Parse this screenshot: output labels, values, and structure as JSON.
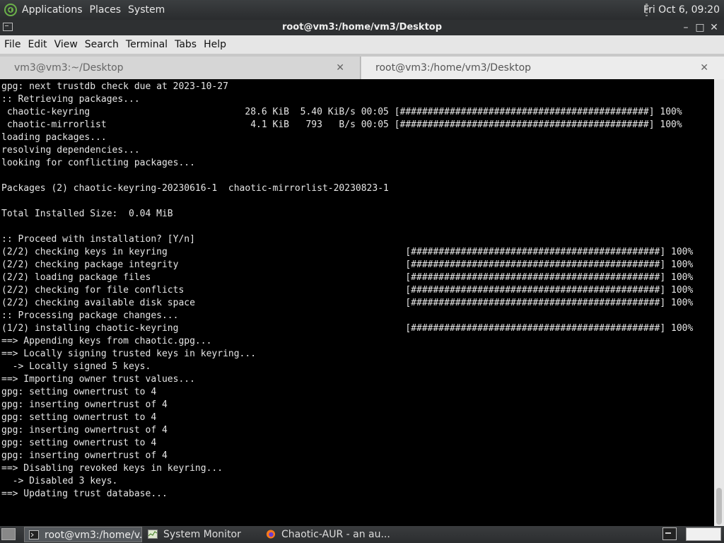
{
  "top_panel": {
    "menus": [
      "Applications",
      "Places",
      "System"
    ],
    "clock": "Fri Oct  6, 09:20"
  },
  "window": {
    "title": "root@vm3:/home/vm3/Desktop",
    "controls": {
      "minimize": "–",
      "maximize": "□",
      "close": "✕"
    }
  },
  "menubar": [
    "File",
    "Edit",
    "View",
    "Search",
    "Terminal",
    "Tabs",
    "Help"
  ],
  "tabs": [
    {
      "label": "vm3@vm3:~/Desktop",
      "close": "✕"
    },
    {
      "label": "root@vm3:/home/vm3/Desktop",
      "close": "✕"
    }
  ],
  "terminal": {
    "lines": [
      "gpg: next trustdb check due at 2023-10-27",
      ":: Retrieving packages...",
      " chaotic-keyring                            28.6 KiB  5.40 KiB/s 00:05 [#############################################] 100%",
      " chaotic-mirrorlist                          4.1 KiB   793   B/s 00:05 [#############################################] 100%",
      "loading packages...",
      "resolving dependencies...",
      "looking for conflicting packages...",
      "",
      "Packages (2) chaotic-keyring-20230616-1  chaotic-mirrorlist-20230823-1",
      "",
      "Total Installed Size:  0.04 MiB",
      "",
      ":: Proceed with installation? [Y/n]",
      "(2/2) checking keys in keyring                                           [#############################################] 100%",
      "(2/2) checking package integrity                                         [#############################################] 100%",
      "(2/2) loading package files                                              [#############################################] 100%",
      "(2/2) checking for file conflicts                                        [#############################################] 100%",
      "(2/2) checking available disk space                                      [#############################################] 100%",
      ":: Processing package changes...",
      "(1/2) installing chaotic-keyring                                         [#############################################] 100%",
      "==> Appending keys from chaotic.gpg...",
      "==> Locally signing trusted keys in keyring...",
      "  -> Locally signed 5 keys.",
      "==> Importing owner trust values...",
      "gpg: setting ownertrust to 4",
      "gpg: inserting ownertrust of 4",
      "gpg: setting ownertrust to 4",
      "gpg: inserting ownertrust of 4",
      "gpg: setting ownertrust to 4",
      "gpg: inserting ownertrust of 4",
      "==> Disabling revoked keys in keyring...",
      "  -> Disabled 3 keys.",
      "==> Updating trust database..."
    ]
  },
  "taskbar": {
    "tasks": [
      {
        "label": "root@vm3:/home/v...",
        "icon": "terminal-icon"
      },
      {
        "label": "System Monitor",
        "icon": "system-monitor-icon"
      },
      {
        "label": "Chaotic-AUR - an au...",
        "icon": "firefox-icon"
      }
    ]
  },
  "colors": {
    "terminal_bg": "#000000",
    "terminal_fg": "#e6e6e6",
    "panel_bg": "#2e3032"
  }
}
